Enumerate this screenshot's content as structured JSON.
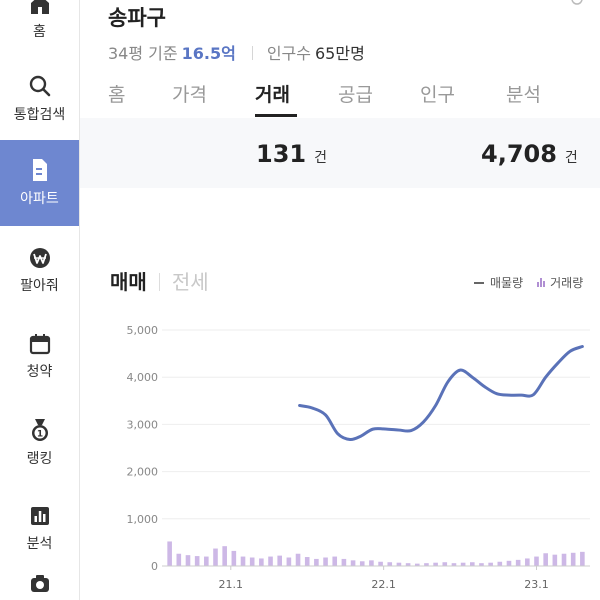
{
  "sidebar": {
    "items": [
      {
        "label": "홈",
        "icon": "home-icon",
        "active": false
      },
      {
        "label": "통합검색",
        "icon": "search-icon",
        "active": false
      },
      {
        "label": "아파트",
        "icon": "apartment-icon",
        "active": true
      },
      {
        "label": "팔아줘",
        "icon": "won-icon",
        "active": false
      },
      {
        "label": "청약",
        "icon": "calendar-icon",
        "active": false
      },
      {
        "label": "랭킹",
        "icon": "medal-icon",
        "active": false
      },
      {
        "label": "분석",
        "icon": "analysis-icon",
        "active": false
      }
    ]
  },
  "header": {
    "title": "송파구",
    "basis": "34평 기준",
    "price": "16.5억",
    "population_label": "인구수",
    "population_value": "65만명"
  },
  "tabs": [
    {
      "label": "홈",
      "active": false
    },
    {
      "label": "가격",
      "active": false
    },
    {
      "label": "거래",
      "active": true
    },
    {
      "label": "공급",
      "active": false
    },
    {
      "label": "인구",
      "active": false
    },
    {
      "label": "분석",
      "active": false
    }
  ],
  "stats": [
    {
      "value": "131",
      "unit": "건"
    },
    {
      "value": "4,708",
      "unit": "건"
    }
  ],
  "chart_tabs": {
    "sale": "매매",
    "rent": "전세"
  },
  "legend": {
    "line": "매물량",
    "bar": "거래량"
  },
  "colors": {
    "accent": "#6e87d0",
    "line": "#5a72b8",
    "bar": "#cdb8e6"
  },
  "chart_data": {
    "type": "line",
    "x_tick_labels": [
      "21.1",
      "22.1",
      "23.1"
    ],
    "x_ticks": [
      2021.0,
      2022.0,
      2023.0
    ],
    "xlim": [
      2020.55,
      2023.35
    ],
    "ylim": [
      0,
      5000
    ],
    "y_ticks": [
      0,
      1000,
      2000,
      3000,
      4000,
      5000
    ],
    "y_tick_labels": [
      "0",
      "1,000",
      "2,000",
      "3,000",
      "4,000",
      "5,000"
    ],
    "grid": true,
    "legend": "top-right",
    "series": [
      {
        "name": "매물량",
        "type": "line",
        "x": [
          2021.45,
          2021.53,
          2021.62,
          2021.7,
          2021.78,
          2021.85,
          2021.93,
          2022.02,
          2022.1,
          2022.18,
          2022.26,
          2022.34,
          2022.42,
          2022.5,
          2022.58,
          2022.66,
          2022.74,
          2022.82,
          2022.9,
          2022.98,
          2023.06,
          2023.14,
          2023.22,
          2023.3
        ],
        "values": [
          3400,
          3350,
          3200,
          2800,
          2680,
          2750,
          2900,
          2900,
          2880,
          2870,
          3050,
          3400,
          3900,
          4150,
          4000,
          3800,
          3650,
          3620,
          3620,
          3630,
          4000,
          4300,
          4550,
          4650
        ]
      },
      {
        "name": "거래량",
        "type": "bar",
        "x": [
          2020.6,
          2020.66,
          2020.72,
          2020.78,
          2020.84,
          2020.9,
          2020.96,
          2021.02,
          2021.08,
          2021.14,
          2021.2,
          2021.26,
          2021.32,
          2021.38,
          2021.44,
          2021.5,
          2021.56,
          2021.62,
          2021.68,
          2021.74,
          2021.8,
          2021.86,
          2021.92,
          2021.98,
          2022.04,
          2022.1,
          2022.16,
          2022.22,
          2022.28,
          2022.34,
          2022.4,
          2022.46,
          2022.52,
          2022.58,
          2022.64,
          2022.7,
          2022.76,
          2022.82,
          2022.88,
          2022.94,
          2023.0,
          2023.06,
          2023.12,
          2023.18,
          2023.24,
          2023.3
        ],
        "values": [
          520,
          260,
          230,
          210,
          200,
          370,
          420,
          320,
          200,
          180,
          160,
          200,
          220,
          180,
          260,
          190,
          150,
          180,
          200,
          150,
          120,
          100,
          120,
          90,
          80,
          70,
          60,
          50,
          60,
          70,
          80,
          60,
          70,
          80,
          60,
          70,
          90,
          110,
          130,
          160,
          200,
          270,
          240,
          260,
          280,
          300
        ]
      }
    ]
  }
}
